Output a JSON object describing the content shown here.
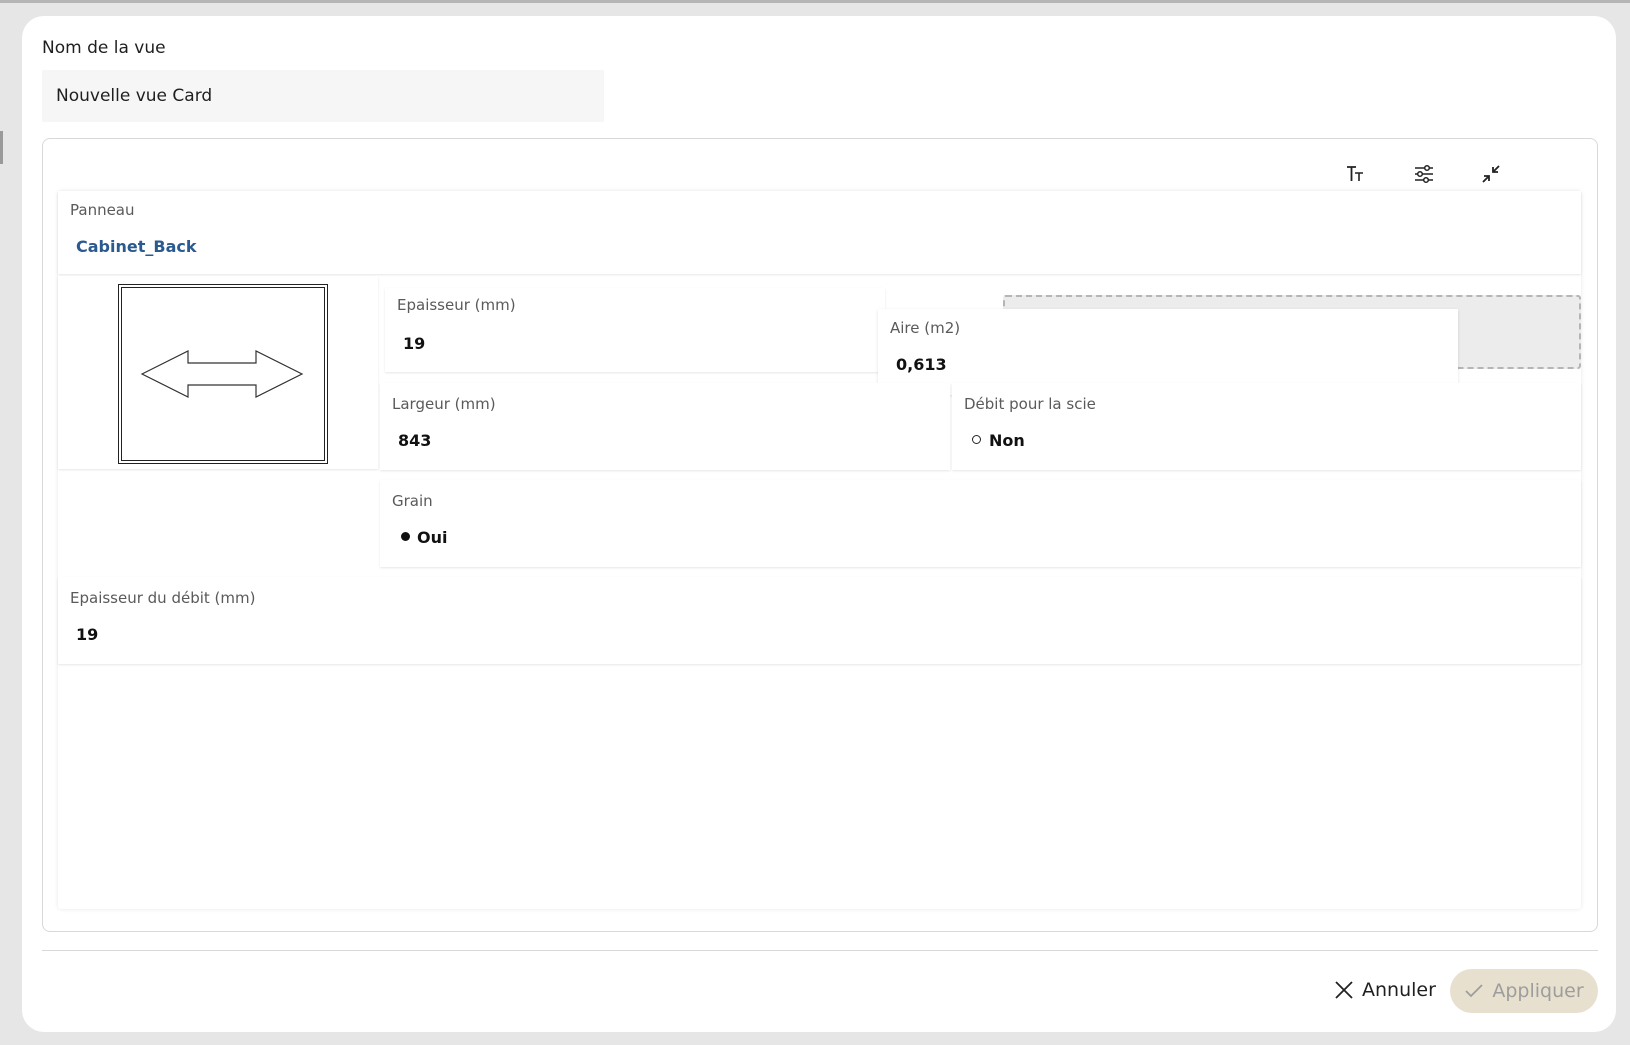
{
  "form": {
    "name_label": "Nom de la vue",
    "name_value": "Nouvelle vue Card"
  },
  "toolbar": {
    "icons": [
      "text-size-icon",
      "settings-sliders-icon",
      "collapse-icon"
    ]
  },
  "card": {
    "panneau": {
      "label": "Panneau",
      "value": "Cabinet_Back"
    },
    "epaisseur": {
      "label": "Epaisseur (mm)",
      "value": "19"
    },
    "aire": {
      "label": "Aire (m2)",
      "value": "0,613"
    },
    "largeur": {
      "label": "Largeur (mm)",
      "value": "843"
    },
    "debit_scie": {
      "label": "Débit pour la scie",
      "value": "Non"
    },
    "grain": {
      "label": "Grain",
      "value": "Oui"
    },
    "epaisseur_debit": {
      "label": "Epaisseur du débit (mm)",
      "value": "19"
    }
  },
  "footer": {
    "cancel_label": "Annuler",
    "apply_label": "Appliquer"
  },
  "colors": {
    "link": "#2a5a8f",
    "apply_bg": "#e8e0cf",
    "apply_text": "#9d9d9d"
  }
}
